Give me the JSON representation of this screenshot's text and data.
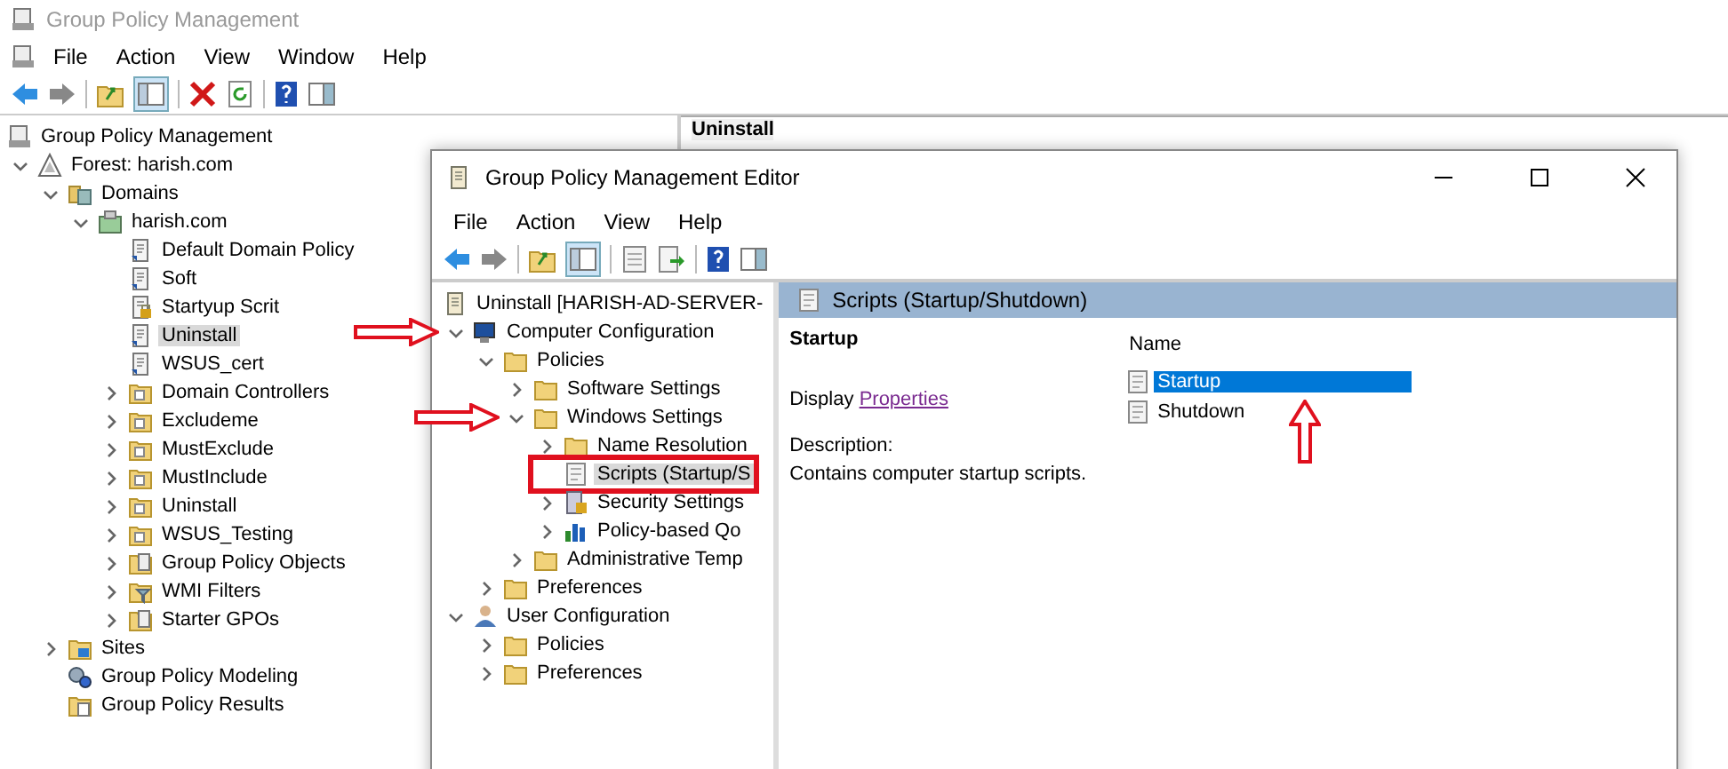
{
  "main_window": {
    "title": "Group Policy Management",
    "menu": [
      "File",
      "Action",
      "View",
      "Window",
      "Help"
    ],
    "tree": [
      {
        "label": "Group Policy Management",
        "kind": "console",
        "selected": false,
        "children": [
          {
            "label": "Forest: harish.com",
            "kind": "forest",
            "expanded": true,
            "selected": false,
            "children": [
              {
                "label": "Domains",
                "kind": "domains",
                "expanded": true,
                "selected": false,
                "children": [
                  {
                    "label": "harish.com",
                    "kind": "domain",
                    "expanded": true,
                    "selected": false,
                    "children": [
                      {
                        "label": "Default Domain Policy",
                        "kind": "gpo",
                        "selected": false
                      },
                      {
                        "label": "Soft",
                        "kind": "gpo",
                        "selected": false
                      },
                      {
                        "label": "Startyup Scrit",
                        "kind": "gpo-locked",
                        "selected": false
                      },
                      {
                        "label": "Uninstall",
                        "kind": "gpo",
                        "selected": true
                      },
                      {
                        "label": "WSUS_cert",
                        "kind": "gpo",
                        "selected": false
                      },
                      {
                        "label": "Domain Controllers",
                        "kind": "ou",
                        "expanded": false,
                        "selected": false
                      },
                      {
                        "label": "Excludeme",
                        "kind": "ou",
                        "expanded": false,
                        "selected": false
                      },
                      {
                        "label": "MustExclude",
                        "kind": "ou",
                        "expanded": false,
                        "selected": false
                      },
                      {
                        "label": "MustInclude",
                        "kind": "ou",
                        "expanded": false,
                        "selected": false
                      },
                      {
                        "label": "Uninstall",
                        "kind": "ou",
                        "expanded": false,
                        "selected": false
                      },
                      {
                        "label": "WSUS_Testing",
                        "kind": "ou",
                        "expanded": false,
                        "selected": false
                      },
                      {
                        "label": "Group Policy Objects",
                        "kind": "gpo-folder",
                        "expanded": false,
                        "selected": false
                      },
                      {
                        "label": "WMI Filters",
                        "kind": "filter",
                        "expanded": false,
                        "selected": false
                      },
                      {
                        "label": "Starter GPOs",
                        "kind": "gpo-folder",
                        "expanded": false,
                        "selected": false
                      }
                    ]
                  }
                ]
              },
              {
                "label": "Sites",
                "kind": "sites",
                "expanded": false,
                "selected": false
              },
              {
                "label": "Group Policy Modeling",
                "kind": "modeling",
                "selected": false
              },
              {
                "label": "Group Policy Results",
                "kind": "results",
                "selected": false
              }
            ]
          }
        ]
      }
    ],
    "details_title": "Uninstall"
  },
  "editor_window": {
    "title": "Group Policy Management Editor",
    "menu": [
      "File",
      "Action",
      "View",
      "Help"
    ],
    "tree": [
      {
        "label": "Uninstall [HARISH-AD-SERVER-",
        "kind": "policy",
        "selected": false,
        "children": [
          {
            "label": "Computer Configuration",
            "kind": "computer",
            "expanded": true,
            "marked": true,
            "selected": false,
            "children": [
              {
                "label": "Policies",
                "kind": "folder",
                "expanded": true,
                "selected": false,
                "children": [
                  {
                    "label": "Software Settings",
                    "kind": "folder",
                    "expanded": false,
                    "selected": false
                  },
                  {
                    "label": "Windows Settings",
                    "kind": "folder",
                    "expanded": true,
                    "marked": true,
                    "selected": false,
                    "children": [
                      {
                        "label": "Name Resolution",
                        "kind": "folder",
                        "expanded": false,
                        "selected": false
                      },
                      {
                        "label": "Scripts (Startup/S",
                        "kind": "script",
                        "selected": true,
                        "highlighted": true
                      },
                      {
                        "label": "Security Settings",
                        "kind": "security",
                        "expanded": false,
                        "selected": false
                      },
                      {
                        "label": "Policy-based Qo",
                        "kind": "chart",
                        "expanded": false,
                        "selected": false
                      }
                    ]
                  },
                  {
                    "label": "Administrative Temp",
                    "kind": "folder",
                    "expanded": false,
                    "selected": false
                  }
                ]
              },
              {
                "label": "Preferences",
                "kind": "folder",
                "expanded": false,
                "selected": false
              }
            ]
          },
          {
            "label": "User Configuration",
            "kind": "user",
            "expanded": true,
            "selected": false,
            "children": [
              {
                "label": "Policies",
                "kind": "folder",
                "expanded": false,
                "selected": false
              },
              {
                "label": "Preferences",
                "kind": "folder",
                "expanded": false,
                "selected": false
              }
            ]
          }
        ]
      }
    ],
    "pane_header": "Scripts (Startup/Shutdown)",
    "detail": {
      "heading": "Startup",
      "display_label": "Display",
      "display_link": "Properties",
      "description_label": "Description:",
      "description": "Contains computer startup scripts."
    },
    "list": {
      "column": "Name",
      "items": [
        {
          "label": "Startup",
          "selected": true,
          "marked": true
        },
        {
          "label": "Shutdown",
          "selected": false,
          "marked": false
        }
      ]
    }
  }
}
